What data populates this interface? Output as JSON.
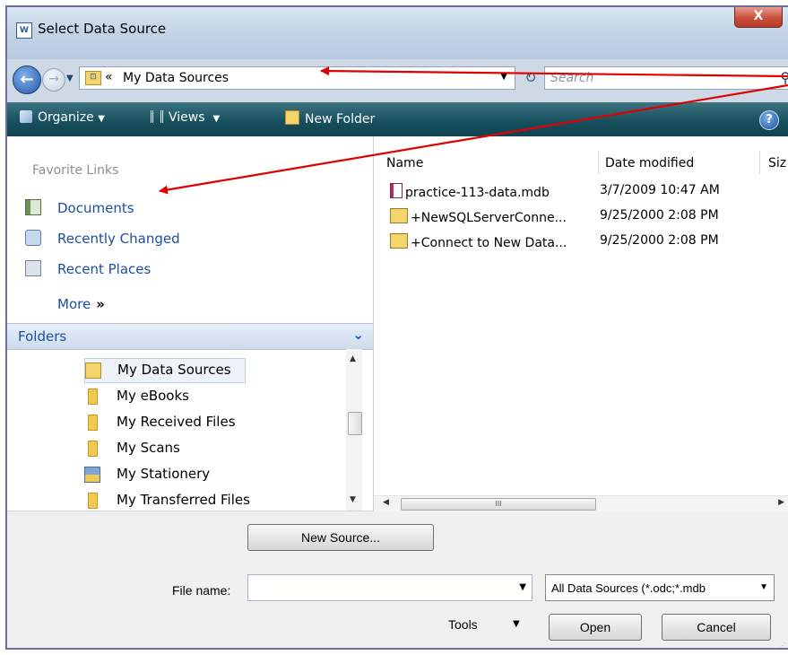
{
  "window": {
    "title": "Select Data Source",
    "close_label": "X"
  },
  "nav": {
    "back_icon": "back-arrow-icon",
    "forward_icon": "forward-arrow-icon"
  },
  "address": {
    "chevron": "«",
    "path": "My Data Sources"
  },
  "search": {
    "placeholder": "Search"
  },
  "toolbar": {
    "organize": "Organize",
    "views": "Views",
    "new_folder": "New Folder",
    "help": "?"
  },
  "favorites": {
    "header": "Favorite Links",
    "items": [
      {
        "label": "Documents",
        "icon": "documents-icon"
      },
      {
        "label": "Recently Changed",
        "icon": "recently-changed-icon"
      },
      {
        "label": "Recent Places",
        "icon": "recent-places-icon"
      }
    ],
    "more": "More",
    "more_chevron": "»"
  },
  "folders": {
    "header": "Folders",
    "items": [
      {
        "label": "My Data Sources"
      },
      {
        "label": "My eBooks"
      },
      {
        "label": "My Received Files"
      },
      {
        "label": "My Scans"
      },
      {
        "label": "My Stationery"
      },
      {
        "label": "My Transferred Files"
      }
    ]
  },
  "columns": {
    "name": "Name",
    "date": "Date modified",
    "size": "Siz"
  },
  "files": [
    {
      "name": "practice-113-data.mdb",
      "date": "3/7/2009 10:47 AM",
      "icon": "mdb-file-icon"
    },
    {
      "name": "+NewSQLServerConne...",
      "date": "9/25/2000 2:08 PM",
      "icon": "odc-file-icon"
    },
    {
      "name": "+Connect to New Data...",
      "date": "9/25/2000 2:08 PM",
      "icon": "odc-file-icon"
    }
  ],
  "scroll": {
    "grip": "III"
  },
  "footer": {
    "new_source": "New Source...",
    "file_name_label": "File name:",
    "file_name_value": "",
    "filter": "All Data Sources (*.odc;*.mdb",
    "tools": "Tools",
    "open": "Open",
    "cancel": "Cancel"
  },
  "colors": {
    "toolbar_bg": "#17505e",
    "link": "#1a4fa3",
    "annotation_arrow": "#e00000",
    "close_button": "#c9503b"
  }
}
